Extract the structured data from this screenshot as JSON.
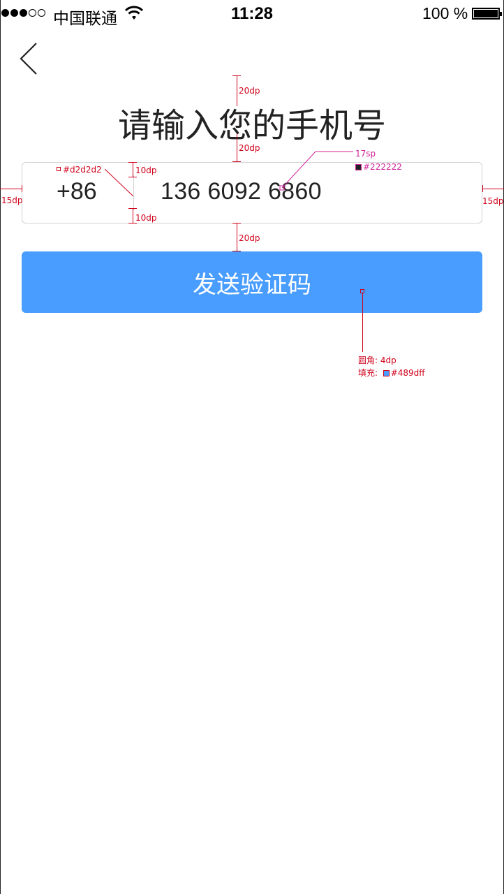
{
  "status_bar": {
    "carrier": "中国联通",
    "time": "11:28",
    "battery": "100 %",
    "signal_icon": "signal-dots-icon",
    "wifi_icon": "wifi-icon",
    "battery_icon": "battery-icon"
  },
  "nav": {
    "back_icon": "chevron-left-icon"
  },
  "title": "请输入您的手机号",
  "phone_input": {
    "country_code": "+86",
    "value": "136 6092 6860",
    "border_color": "#d2d2d2",
    "text_color": "#222222"
  },
  "send_button": {
    "label": "发送验证码",
    "color": "#489dff"
  },
  "annotations": {
    "gap_top": "20dp",
    "gap_title_input": "20dp",
    "gap_input_button": "20dp",
    "border_color_label": "#d2d2d2",
    "pad_top": "10dp",
    "pad_bottom": "10dp",
    "font_size": "17sp",
    "text_color_label": "#222222",
    "margin_left": "15dp",
    "margin_right": "15dp",
    "radius_label": "圆角: 4dp",
    "fill_label": "填充:",
    "fill_color": "#489dff"
  }
}
